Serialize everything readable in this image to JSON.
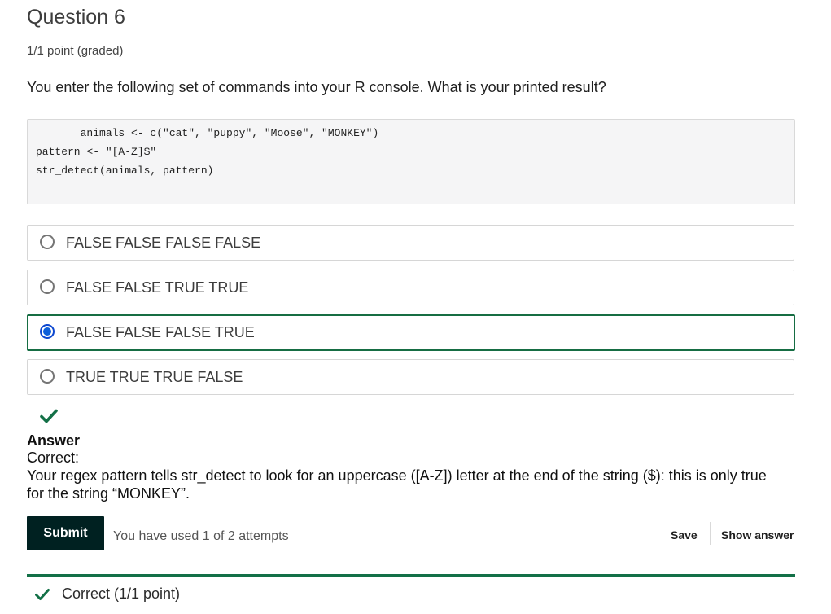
{
  "question": {
    "title": "Question 6",
    "points": "1/1 point (graded)",
    "prompt": "You enter the following set of commands into your R console. What is your printed result?"
  },
  "code": {
    "lines": [
      "       animals <- c(\"cat\", \"puppy\", \"Moose\", \"MONKEY\")",
      "pattern <- \"[A-Z]$\"",
      "str_detect(animals, pattern)"
    ]
  },
  "options": [
    {
      "label": "FALSE FALSE FALSE FALSE",
      "selected": false
    },
    {
      "label": "FALSE FALSE TRUE TRUE",
      "selected": false
    },
    {
      "label": "FALSE FALSE FALSE TRUE",
      "selected": true
    },
    {
      "label": "TRUE TRUE TRUE FALSE",
      "selected": false
    }
  ],
  "answer": {
    "icon": "check-icon",
    "heading": "Answer",
    "status": "Correct:",
    "explanation": "Your regex pattern tells str_detect to look for an uppercase ([A-Z]) letter at the end of the string ($): this is only true for the string “MONKEY”."
  },
  "actions": {
    "submit_label": "Submit",
    "attempts_text": "You have used 1 of 2 attempts",
    "save_label": "Save",
    "show_answer_label": "Show answer"
  },
  "footer": {
    "icon": "check-icon",
    "status_text": "Correct (1/1 point)"
  },
  "colors": {
    "accent_green": "#137047",
    "selected_blue": "#0d5fd9",
    "submit_bg": "#002121"
  }
}
